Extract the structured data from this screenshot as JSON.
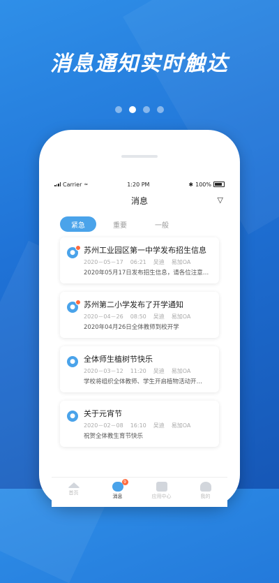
{
  "headline": "消息通知实时触达",
  "status": {
    "carrier": "Carrier",
    "time": "1:20 PM",
    "battery": "100%"
  },
  "nav": {
    "title": "消息"
  },
  "tabs": [
    {
      "label": "紧急"
    },
    {
      "label": "重要"
    },
    {
      "label": "一般"
    }
  ],
  "messages": [
    {
      "title": "苏州工业园区第一中学发布招生信息",
      "date": "2020－05－17",
      "time": "06:21",
      "author": "吴迪",
      "source": "易加OA",
      "desc": "2020年05月17日发布招生信息，请各位注意…"
    },
    {
      "title": "苏州第二小学发布了开学通知",
      "date": "2020－04－26",
      "time": "08:50",
      "author": "吴迪",
      "source": "易加OA",
      "desc": "2020年04月26日全体教师到校开学"
    },
    {
      "title": "全体师生植树节快乐",
      "date": "2020－03－12",
      "time": "11:20",
      "author": "吴迪",
      "source": "易加OA",
      "desc": "学校将组织全体教师、学生开启植物活动开…"
    },
    {
      "title": "关于元宵节",
      "date": "2020－02－08",
      "time": "16:10",
      "author": "吴迪",
      "source": "易加OA",
      "desc": "祝贺全体教生育节快乐"
    }
  ],
  "tabbar": [
    {
      "label": "首页"
    },
    {
      "label": "消息",
      "badge": "9"
    },
    {
      "label": "应用中心"
    },
    {
      "label": "我的"
    }
  ],
  "colors": {
    "accent": "#4aa3ea",
    "badge": "#ff6a3d",
    "background": "#1f72d6"
  }
}
